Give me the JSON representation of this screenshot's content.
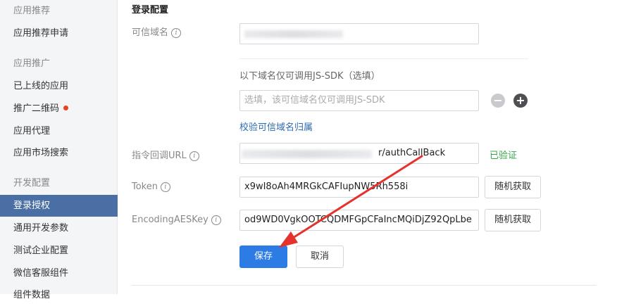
{
  "sidebar": {
    "items": [
      {
        "label": "应用推荐",
        "type": "group"
      },
      {
        "label": "应用推荐申请",
        "type": "item"
      },
      {
        "label": "应用推广",
        "type": "group"
      },
      {
        "label": "已上线的应用",
        "type": "item"
      },
      {
        "label": "推广二维码",
        "type": "item",
        "badge_color": "#e8431e"
      },
      {
        "label": "应用代理",
        "type": "item"
      },
      {
        "label": "应用市场搜索",
        "type": "item"
      },
      {
        "label": "开发配置",
        "type": "group"
      },
      {
        "label": "登录授权",
        "type": "item",
        "active": true
      },
      {
        "label": "通用开发参数",
        "type": "item"
      },
      {
        "label": "测试企业配置",
        "type": "item"
      },
      {
        "label": "微信客服组件",
        "type": "item"
      },
      {
        "label": "组件数据",
        "type": "item"
      }
    ],
    "active_color": "#4a6fa5"
  },
  "form": {
    "title": "登录配置",
    "trusted_domain": {
      "label": "可信域名"
    },
    "jssdk_hint": "以下域名仅可调用JS-SDK（选填）",
    "jssdk_input": {
      "placeholder": "选填，该可信域名仅可调用JS-SDK"
    },
    "verify_link": "校验可信域名归属",
    "callback_url": {
      "label": "指令回调URL",
      "value_visible": "r/authCallBack",
      "status": "已验证"
    },
    "token": {
      "label": "Token",
      "value": "x9wI8oAh4MRGkCAFIupNW5Rh558i",
      "button": "随机获取"
    },
    "aes_key": {
      "label": "EncodingAESKey",
      "value": "od9WD0VgkOOTCQDMFGpCFaIncMQiDjZ92QpLbe",
      "button": "随机获取"
    },
    "save_button": "保存",
    "cancel_button": "取消"
  },
  "colors": {
    "primary": "#2d7be5",
    "success": "#3aa44a",
    "link": "#2f6bb0",
    "arrow": "#e5322d"
  },
  "icons": {
    "info": "info-circle-icon",
    "minus": "minus-circle-icon",
    "plus": "plus-circle-icon",
    "arrow": "red-arrow-annotation"
  }
}
